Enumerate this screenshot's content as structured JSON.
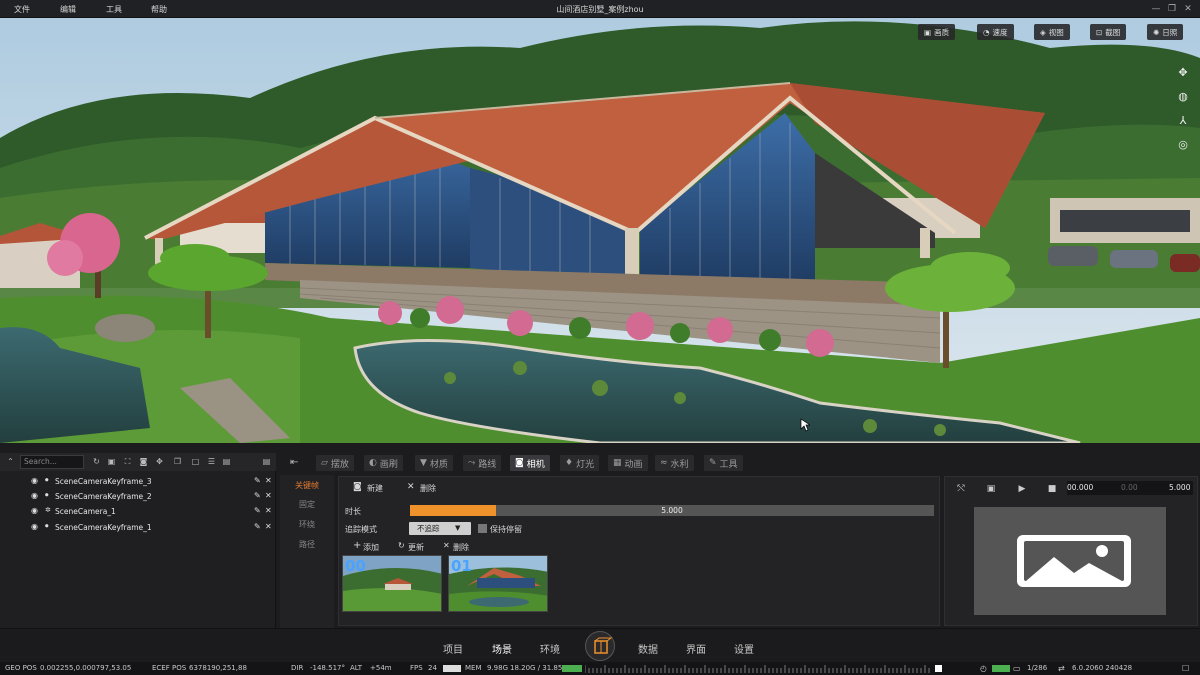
{
  "menu": [
    "文件",
    "编辑",
    "工具",
    "帮助"
  ],
  "window_title": "山间酒店别墅_案例zhou",
  "viewport": {
    "toolbar": [
      {
        "label": "画质",
        "icon": "image-icon"
      },
      {
        "label": "速度",
        "icon": "speed-icon"
      },
      {
        "label": "视图",
        "icon": "view-icon"
      },
      {
        "label": "截图",
        "icon": "screenshot-icon"
      },
      {
        "label": "日照",
        "icon": "sun-icon"
      }
    ],
    "side_tools": [
      "move-icon",
      "orbit-icon",
      "axis-icon",
      "globe-icon"
    ]
  },
  "outliner": {
    "search_placeholder": "Search...",
    "items": [
      {
        "label": "SceneCameraKeyframe_3"
      },
      {
        "label": "SceneCameraKeyframe_2"
      },
      {
        "label": "SceneCamera_1"
      },
      {
        "label": "SceneCameraKeyframe_1"
      }
    ]
  },
  "tabs": [
    {
      "label": "摆放",
      "icon": "place-icon"
    },
    {
      "label": "画刷",
      "icon": "brush-icon"
    },
    {
      "label": "材质",
      "icon": "material-icon"
    },
    {
      "label": "路线",
      "icon": "route-icon"
    },
    {
      "label": "相机",
      "icon": "camera-icon",
      "active": true
    },
    {
      "label": "灯光",
      "icon": "light-icon"
    },
    {
      "label": "动画",
      "icon": "animation-icon"
    },
    {
      "label": "水利",
      "icon": "water-icon"
    },
    {
      "label": "工具",
      "icon": "tool-icon"
    }
  ],
  "subnav": [
    "关键帧",
    "固定",
    "环绕",
    "路径"
  ],
  "camera": {
    "new_label": "新建",
    "delete_label": "删除",
    "duration_label": "时长",
    "duration_value": "5.000",
    "duration_fraction": 0.165,
    "track_mode_label": "追踪模式",
    "track_mode_value": "不追踪",
    "keep_stop_label": "保持停留",
    "add_label": "添加",
    "update_label": "更新",
    "delete2_label": "删除",
    "thumbnails": [
      "00",
      "01"
    ]
  },
  "preview": {
    "time_start": "00.000",
    "time_mid": "0.00",
    "time_end": "5.000"
  },
  "bottom_nav": [
    "项目",
    "场景",
    "环境",
    "数据",
    "界面",
    "设置"
  ],
  "status": {
    "geo_pos_label": "GEO POS",
    "geo_pos": "0.002255,0.000797,53.05",
    "ecef_pos_label": "ECEF POS",
    "ecef_pos": "6378190,251,88",
    "dir_label": "DIR",
    "dir": "-148.517°",
    "alt_label": "ALT",
    "alt": "+54m",
    "fps_label": "FPS",
    "fps": "24",
    "mem_label": "MEM",
    "mem": "9.98G",
    "gpu_mem": "18.20G / 31.85G",
    "page": "1/286",
    "version": "6.0.2060 240428"
  }
}
